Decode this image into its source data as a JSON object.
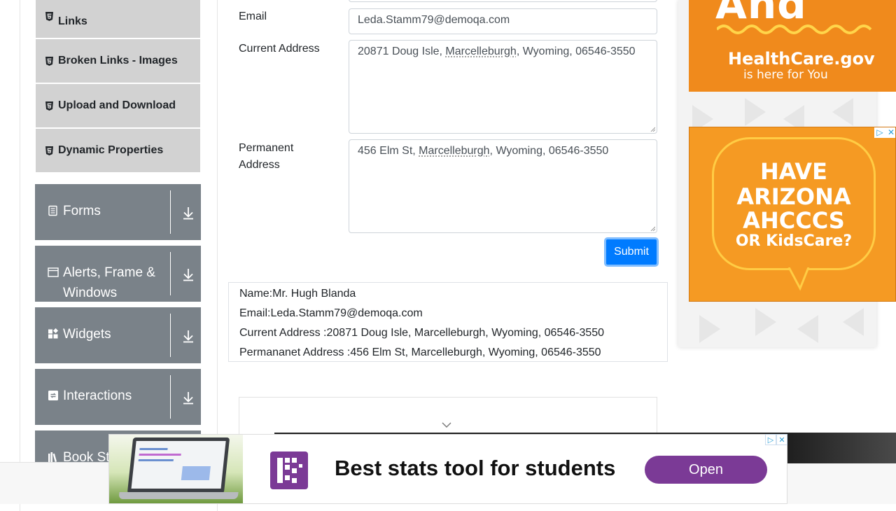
{
  "sidebar": {
    "elements_items": [
      {
        "label": "Links"
      },
      {
        "label": "Broken Links - Images"
      },
      {
        "label": "Upload and Download"
      },
      {
        "label": "Dynamic Properties"
      }
    ],
    "groups": [
      {
        "label": "Forms",
        "icon": "form-icon"
      },
      {
        "label": "Alerts, Frame & Windows",
        "icon": "window-icon"
      },
      {
        "label": "Widgets",
        "icon": "widgets-icon"
      },
      {
        "label": "Interactions",
        "icon": "interactions-icon"
      },
      {
        "label": "Book Store Application",
        "visible_label": "Book St",
        "icon": "books-icon"
      }
    ]
  },
  "form": {
    "email_label": "Email",
    "email_value": "Leda.Stamm79@demoqa.com",
    "current_address_label": "Current Address",
    "current_address_pre": "20871 Doug Isle, ",
    "current_address_city": "Marcelleburgh",
    "current_address_post": ", Wyoming, 06546-3550",
    "permanent_address_label": "Permanent Address",
    "permanent_address_pre": "456 Elm St, ",
    "permanent_address_city": "Marcelleburgh",
    "permanent_address_post": ", Wyoming, 06546-3550",
    "submit_label": "Submit"
  },
  "output": {
    "name": "Name:Mr. Hugh Blanda",
    "email": "Email:Leda.Stamm79@demoqa.com",
    "current_address": "Current Address :20871 Doug Isle, Marcelleburgh, Wyoming, 06546-3550",
    "permanent_address": "Permananet Address :456 Elm St, Marcelleburgh, Wyoming, 06546-3550"
  },
  "ads": {
    "healthcare_partial": "And",
    "healthcare_name": "HealthCare.gov",
    "healthcare_tag": "is here for You",
    "arizona_line1": "HAVE",
    "arizona_line2": "ARIZONA",
    "arizona_line3": "AHCCCS",
    "arizona_line4": "OR KidsCare?",
    "bottom_headline": "Best stats tool for students",
    "bottom_button": "Open"
  },
  "colors": {
    "primary": "#007bff",
    "sidebar_group": "#7a8289",
    "sidebar_item": "#d2d2d2",
    "ad_orange": "#f59a23",
    "ad_purple": "#7b3a96"
  }
}
